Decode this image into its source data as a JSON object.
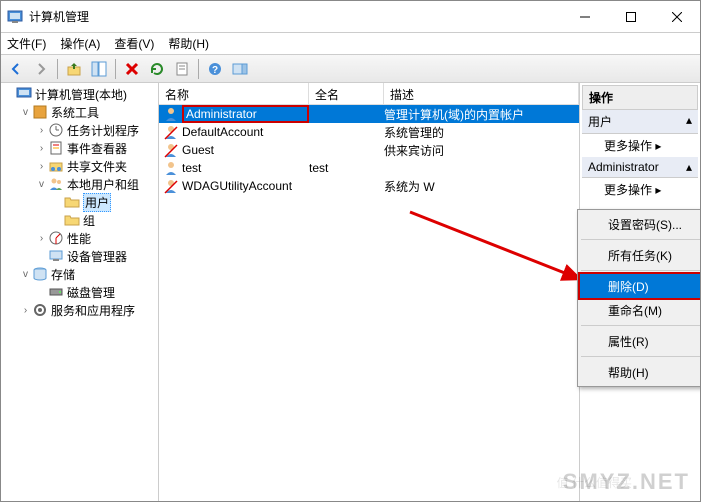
{
  "window": {
    "title": "计算机管理"
  },
  "menubar": {
    "file": "文件(F)",
    "action": "操作(A)",
    "view": "查看(V)",
    "help": "帮助(H)"
  },
  "nav": {
    "root": "计算机管理(本地)",
    "systools": "系统工具",
    "tasksched": "任务计划程序",
    "eventvwr": "事件查看器",
    "shared": "共享文件夹",
    "localusers": "本地用户和组",
    "users": "用户",
    "groups": "组",
    "perf": "性能",
    "devmgr": "设备管理器",
    "storage": "存储",
    "diskmgmt": "磁盘管理",
    "services": "服务和应用程序"
  },
  "columns": {
    "name": "名称",
    "fullname": "全名",
    "desc": "描述"
  },
  "rows": [
    {
      "name": "Administrator",
      "full": "",
      "desc": "管理计算机(域)的内置帐户",
      "selected": true
    },
    {
      "name": "DefaultAccount",
      "full": "",
      "desc": "系统管理的"
    },
    {
      "name": "Guest",
      "full": "",
      "desc": "供来宾访问"
    },
    {
      "name": "test",
      "full": "test",
      "desc": ""
    },
    {
      "name": "WDAGUtilityAccount",
      "full": "",
      "desc": "系统为 W"
    }
  ],
  "actions": {
    "header": "操作",
    "sect1": "用户",
    "more1": "更多操作",
    "sect2": "Administrator",
    "more2": "更多操作"
  },
  "ctx": {
    "setpwd": "设置密码(S)...",
    "alltasks": "所有任务(K)",
    "delete": "删除(D)",
    "rename": "重命名(M)",
    "props": "属性(R)",
    "help": "帮助(H)"
  },
  "watermark": "SMYZ.NET",
  "watermark2": "值 什么值得买"
}
